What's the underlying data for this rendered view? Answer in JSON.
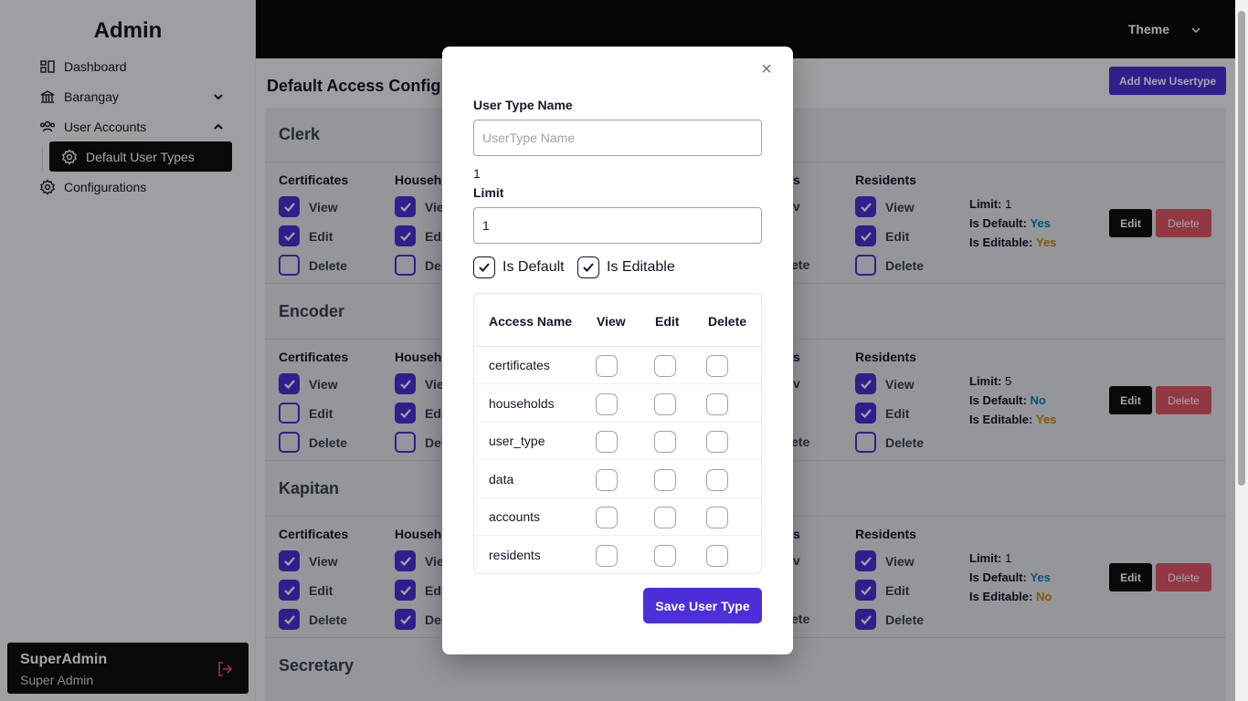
{
  "sidebar": {
    "brand": "Admin",
    "items": [
      {
        "label": "Dashboard",
        "icon": "dashboard-icon"
      },
      {
        "label": "Barangay",
        "icon": "bank-icon"
      },
      {
        "label": "User Accounts",
        "icon": "users-icon"
      },
      {
        "label": "Configurations",
        "icon": "gear-icon"
      }
    ],
    "sub_item": {
      "label": "Default User Types",
      "icon": "gear-icon"
    },
    "user": {
      "name": "SuperAdmin",
      "role": "Super Admin"
    }
  },
  "topbar": {
    "theme_label": "Theme"
  },
  "main": {
    "title": "Default Access Config",
    "add_button": "Add New Usertype",
    "edit_label": "Edit",
    "delete_label": "Delete",
    "columns": [
      "Certificates",
      "Househo",
      "s",
      "Residents"
    ],
    "perm_labels": [
      "View",
      "Edit",
      "Delete"
    ],
    "meta_labels": {
      "limit": "Limit:",
      "is_default": "Is Default:",
      "is_editable": "Is Editable:"
    },
    "user_types": [
      {
        "name": "Clerk",
        "limit": "1",
        "is_default": "Yes",
        "is_editable": "Yes",
        "certificates": [
          true,
          true,
          false
        ],
        "households": [
          true,
          true,
          false
        ],
        "residents": [
          true,
          true,
          false
        ],
        "hidden_col_texts": [
          "v",
          "",
          "ete"
        ]
      },
      {
        "name": "Encoder",
        "limit": "5",
        "is_default": "No",
        "is_editable": "Yes",
        "certificates": [
          true,
          false,
          false
        ],
        "households": [
          true,
          true,
          false
        ],
        "residents": [
          true,
          true,
          false
        ],
        "hidden_col_texts": [
          "v",
          "",
          "ete"
        ]
      },
      {
        "name": "Kapitan",
        "limit": "1",
        "is_default": "Yes",
        "is_editable": "No",
        "certificates": [
          true,
          true,
          true
        ],
        "households": [
          true,
          true,
          true
        ],
        "residents": [
          true,
          true,
          true
        ],
        "hidden_col_texts": [
          "v",
          "",
          "ete"
        ]
      },
      {
        "name": "Secretary"
      }
    ],
    "household_partial_labels": [
      "Vie",
      "Edi",
      "Del"
    ]
  },
  "modal": {
    "user_type_label": "User Type Name",
    "user_type_placeholder": "UserType Name",
    "limit_display": "1",
    "limit_label": "Limit",
    "limit_value": "1",
    "is_default_label": "Is Default",
    "is_editable_label": "Is Editable",
    "is_default_checked": true,
    "is_editable_checked": true,
    "table_headers": [
      "Access Name",
      "View",
      "Edit",
      "Delete"
    ],
    "rows": [
      "certificates",
      "households",
      "user_type",
      "data",
      "accounts",
      "residents"
    ],
    "save_button": "Save User Type",
    "close_symbol": "×"
  },
  "colors": {
    "accent": "#4c2fd9",
    "danger": "#e0566a",
    "dark": "#0f0f10",
    "link_blue": "#0284c7",
    "amber": "#ca8a04"
  }
}
